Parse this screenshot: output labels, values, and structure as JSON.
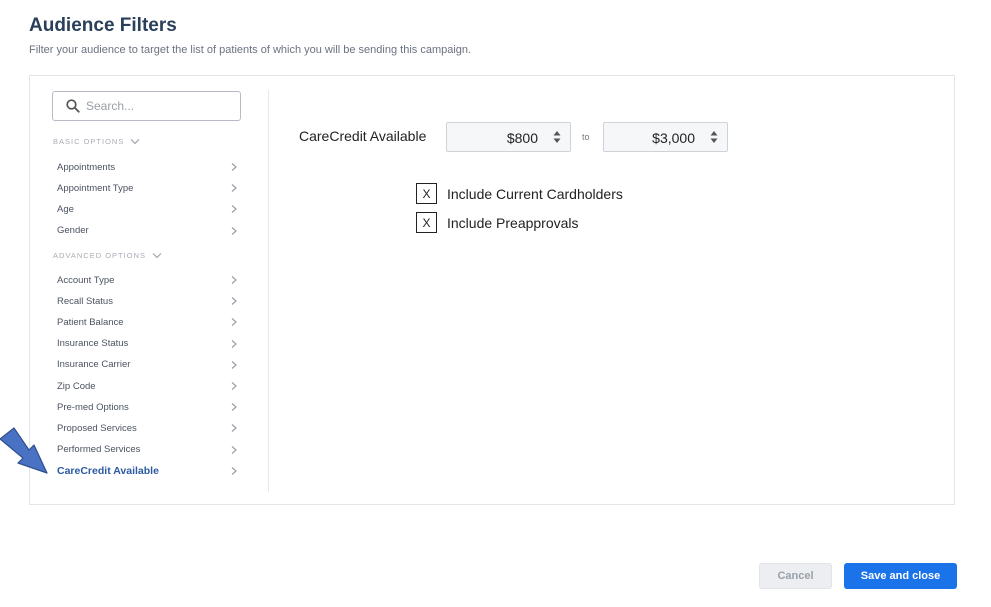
{
  "header": {
    "title": "Audience Filters",
    "subtitle": "Filter your audience to target the list of patients of which you will be sending this campaign."
  },
  "search": {
    "placeholder": "Search..."
  },
  "sidebar": {
    "basic_header": "BASIC OPTIONS",
    "basic_items": [
      "Appointments",
      "Appointment Type",
      "Age",
      "Gender"
    ],
    "advanced_header": "ADVANCED OPTIONS",
    "advanced_items": [
      "Account Type",
      "Recall Status",
      "Patient Balance",
      "Insurance Status",
      "Insurance Carrier",
      "Zip Code",
      "Pre-med Options",
      "Proposed Services",
      "Performed Services",
      "CareCredit Available"
    ],
    "active_item": "CareCredit Available"
  },
  "filter": {
    "label": "CareCredit Available",
    "min_value": "$800",
    "to_label": "to",
    "max_value": "$3,000"
  },
  "checkboxes": [
    {
      "mark": "X",
      "label": "Include Current Cardholders"
    },
    {
      "mark": "X",
      "label": "Include Preapprovals"
    }
  ],
  "footer": {
    "cancel_label": "Cancel",
    "save_label": "Save and close"
  },
  "colors": {
    "title": "#2a3f5a",
    "accent": "#1a73e8",
    "active_item": "#2b5aa0",
    "arrow": "#4a72c4"
  }
}
